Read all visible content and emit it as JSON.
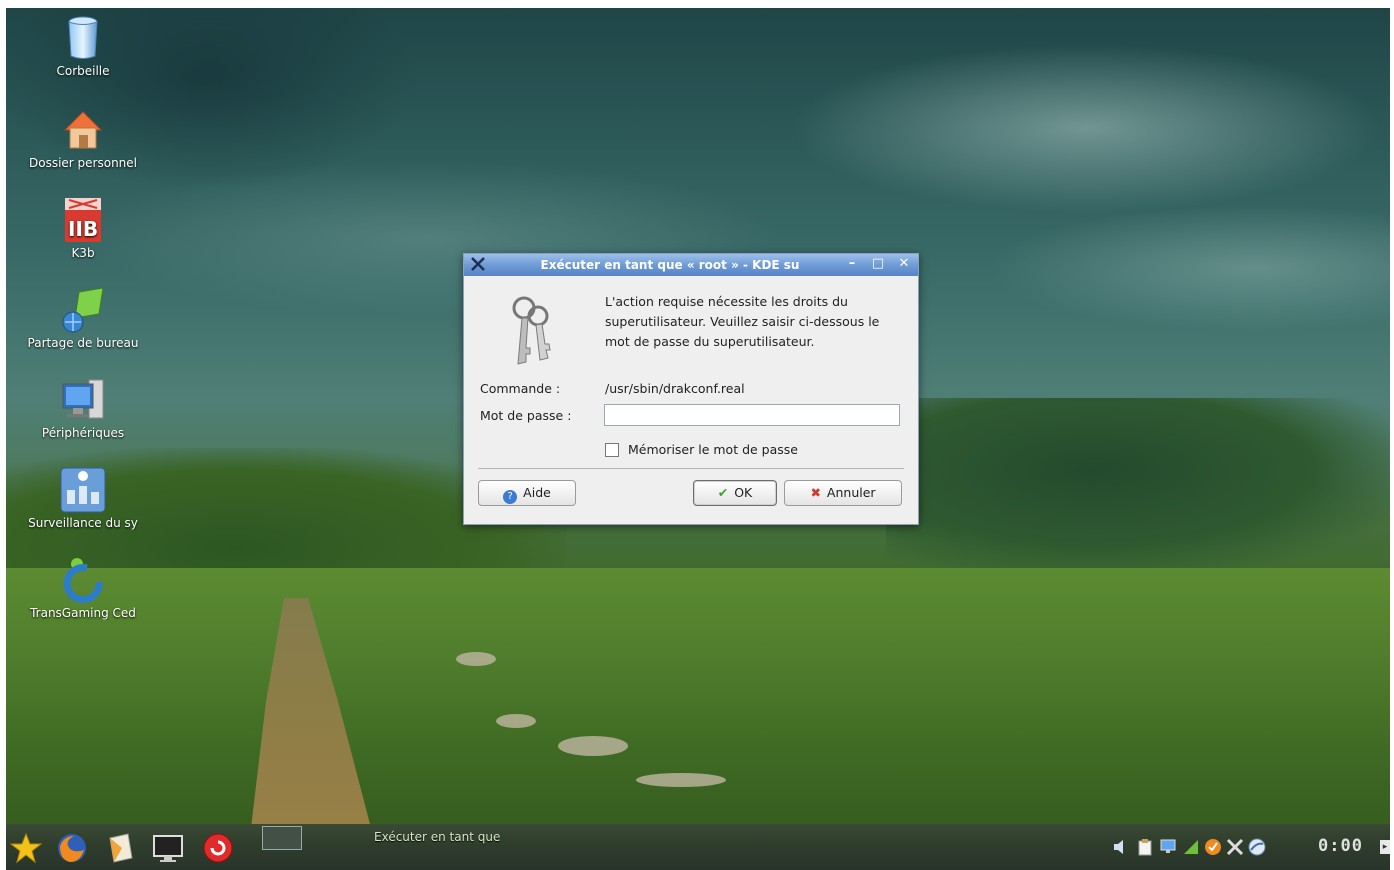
{
  "desktop": {
    "icons": [
      {
        "label": "Corbeille",
        "icon": "trash-icon"
      },
      {
        "label": "Dossier personnel",
        "icon": "home-folder-icon"
      },
      {
        "label": "K3b",
        "icon": "k3b-icon"
      },
      {
        "label": "Partage de bureau",
        "icon": "desktop-sharing-icon"
      },
      {
        "label": "Périphériques",
        "icon": "devices-icon"
      },
      {
        "label": "Surveillance du sy",
        "icon": "system-monitor-icon"
      },
      {
        "label": "TransGaming Ced",
        "icon": "transgaming-icon"
      }
    ]
  },
  "dialog": {
    "title": "Exécuter en tant que « root » - KDE su",
    "title_icon": "kde-x-icon",
    "minimize": "–",
    "maximize": "□",
    "close": "✕",
    "keys_icon": "keys-icon",
    "message": "L'action requise nécessite les droits du superutilisateur. Veuillez saisir ci-dessous le mot de passe du superutilisateur.",
    "command_label": "Commande :",
    "command_value": "/usr/sbin/drakconf.real",
    "password_label": "Mot de passe :",
    "password_value": "",
    "remember_label": "Mémoriser le mot de passe",
    "remember_checked": false,
    "help_button": "Aide",
    "ok_button": "OK",
    "cancel_button": "Annuler"
  },
  "taskbar": {
    "launchers": [
      "kde-menu-star-icon",
      "firefox-icon",
      "file-manager-icon",
      "terminal-monitor-icon",
      "red-app-icon"
    ],
    "task_label": "Exécuter en tant que",
    "tray": [
      "volume-icon",
      "clipboard-icon",
      "network-monitor-icon",
      "signal-icon",
      "update-icon",
      "tools-icon",
      "globe-icon"
    ],
    "clock": "0:00"
  }
}
